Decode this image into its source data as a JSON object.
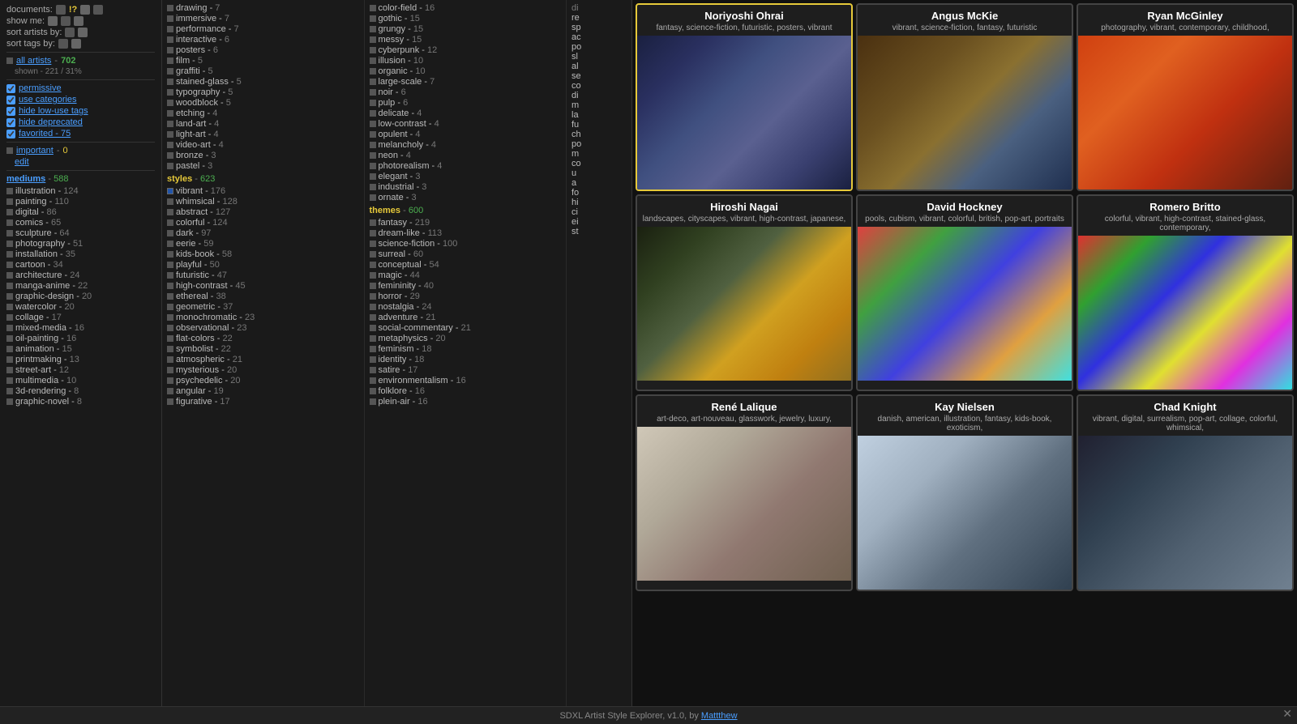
{
  "header": {
    "documents_label": "documents:",
    "show_me_label": "show me:",
    "sort_artists_label": "sort artists by:",
    "sort_tags_label": "sort tags by:"
  },
  "filters": {
    "all_artists_label": "all artists",
    "all_artists_count": "702",
    "shown_label": "shown - 221 / 31%",
    "permissive_label": "permissive",
    "use_categories_label": "use categories",
    "hide_low_label": "hide low-use tags",
    "hide_deprecated_label": "hide deprecated",
    "favorited_label": "favorited - 75",
    "important_label": "important",
    "important_count": "0",
    "edit_label": "edit"
  },
  "mediums": {
    "title": "mediums",
    "count": "588",
    "items": [
      {
        "label": "illustration",
        "count": "124"
      },
      {
        "label": "painting",
        "count": "110"
      },
      {
        "label": "digital",
        "count": "86"
      },
      {
        "label": "comics",
        "count": "65"
      },
      {
        "label": "sculpture",
        "count": "64"
      },
      {
        "label": "photography",
        "count": "51"
      },
      {
        "label": "installation",
        "count": "35"
      },
      {
        "label": "cartoon",
        "count": "34"
      },
      {
        "label": "architecture",
        "count": "24"
      },
      {
        "label": "manga-anime",
        "count": "22"
      },
      {
        "label": "graphic-design",
        "count": "20"
      },
      {
        "label": "watercolor",
        "count": "20"
      },
      {
        "label": "collage",
        "count": "17"
      },
      {
        "label": "mixed-media",
        "count": "16"
      },
      {
        "label": "oil-painting",
        "count": "16"
      },
      {
        "label": "animation",
        "count": "15"
      },
      {
        "label": "printmaking",
        "count": "13"
      },
      {
        "label": "street-art",
        "count": "12"
      },
      {
        "label": "multimedia",
        "count": "10"
      },
      {
        "label": "3d-rendering",
        "count": "8"
      },
      {
        "label": "graphic-novel",
        "count": "8"
      }
    ]
  },
  "styles_col": {
    "title": "styles",
    "count": "623",
    "items": [
      {
        "label": "drawing",
        "count": "7",
        "checked": false
      },
      {
        "label": "immersive",
        "count": "7",
        "checked": false
      },
      {
        "label": "performance",
        "count": "7",
        "checked": false
      },
      {
        "label": "interactive",
        "count": "6",
        "checked": false
      },
      {
        "label": "posters",
        "count": "6",
        "checked": false
      },
      {
        "label": "film",
        "count": "5",
        "checked": false
      },
      {
        "label": "graffiti",
        "count": "5",
        "checked": false
      },
      {
        "label": "stained-glass",
        "count": "5",
        "checked": false
      },
      {
        "label": "typography",
        "count": "5",
        "checked": false
      },
      {
        "label": "woodblock",
        "count": "5",
        "checked": false
      },
      {
        "label": "etching",
        "count": "4",
        "checked": false
      },
      {
        "label": "land-art",
        "count": "4",
        "checked": false
      },
      {
        "label": "light-art",
        "count": "4",
        "checked": false
      },
      {
        "label": "video-art",
        "count": "4",
        "checked": false
      },
      {
        "label": "bronze",
        "count": "3",
        "checked": false
      },
      {
        "label": "pastel",
        "count": "3",
        "checked": false
      }
    ],
    "styles_items": [
      {
        "label": "vibrant",
        "count": "176",
        "checked": true
      },
      {
        "label": "whimsical",
        "count": "128",
        "checked": false
      },
      {
        "label": "abstract",
        "count": "127",
        "checked": false
      },
      {
        "label": "colorful",
        "count": "124",
        "checked": false
      },
      {
        "label": "dark",
        "count": "97",
        "checked": false
      },
      {
        "label": "eerie",
        "count": "59",
        "checked": false
      },
      {
        "label": "kids-book",
        "count": "58",
        "checked": false
      },
      {
        "label": "playful",
        "count": "50",
        "checked": false
      },
      {
        "label": "futuristic",
        "count": "47",
        "checked": false
      },
      {
        "label": "high-contrast",
        "count": "45",
        "checked": false
      },
      {
        "label": "ethereal",
        "count": "38",
        "checked": false
      },
      {
        "label": "geometric",
        "count": "37",
        "checked": false
      },
      {
        "label": "monochromatic",
        "count": "23",
        "checked": false
      },
      {
        "label": "observational",
        "count": "23",
        "checked": false
      },
      {
        "label": "flat-colors",
        "count": "22",
        "checked": false
      },
      {
        "label": "symbolist",
        "count": "22",
        "checked": false
      },
      {
        "label": "atmospheric",
        "count": "21",
        "checked": false
      },
      {
        "label": "mysterious",
        "count": "20",
        "checked": false
      },
      {
        "label": "psychedelic",
        "count": "20",
        "checked": false
      },
      {
        "label": "angular",
        "count": "19",
        "checked": false
      },
      {
        "label": "figurative",
        "count": "17",
        "checked": false
      }
    ]
  },
  "col2": {
    "items": [
      {
        "label": "color-field",
        "count": "16"
      },
      {
        "label": "gothic",
        "count": "15"
      },
      {
        "label": "grungy",
        "count": "15"
      },
      {
        "label": "messy",
        "count": "15"
      },
      {
        "label": "cyberpunk",
        "count": "12"
      },
      {
        "label": "illusion",
        "count": "10"
      },
      {
        "label": "organic",
        "count": "10"
      },
      {
        "label": "large-scale",
        "count": "7"
      },
      {
        "label": "noir",
        "count": "6"
      },
      {
        "label": "pulp",
        "count": "6"
      },
      {
        "label": "delicate",
        "count": "4"
      },
      {
        "label": "low-contrast",
        "count": "4"
      },
      {
        "label": "opulent",
        "count": "4"
      },
      {
        "label": "melancholy",
        "count": "4"
      },
      {
        "label": "neon",
        "count": "4"
      },
      {
        "label": "photorealism",
        "count": "4"
      },
      {
        "label": "elegant",
        "count": "3"
      },
      {
        "label": "industrial",
        "count": "3"
      },
      {
        "label": "ornate",
        "count": "3"
      }
    ],
    "themes_title": "themes",
    "themes_count": "600",
    "themes_items": [
      {
        "label": "fantasy",
        "count": "219"
      },
      {
        "label": "dream-like",
        "count": "113"
      },
      {
        "label": "science-fiction",
        "count": "100"
      },
      {
        "label": "surreal",
        "count": "60"
      },
      {
        "label": "conceptual",
        "count": "54"
      },
      {
        "label": "magic",
        "count": "44"
      },
      {
        "label": "femininity",
        "count": "40"
      },
      {
        "label": "horror",
        "count": "29"
      },
      {
        "label": "nostalgia",
        "count": "24"
      },
      {
        "label": "adventure",
        "count": "21"
      },
      {
        "label": "social-commentary",
        "count": "21"
      },
      {
        "label": "metaphysics",
        "count": "20"
      },
      {
        "label": "feminism",
        "count": "18"
      },
      {
        "label": "identity",
        "count": "18"
      },
      {
        "label": "satire",
        "count": "17"
      },
      {
        "label": "environmentalism",
        "count": "16"
      },
      {
        "label": "folklore",
        "count": "16"
      },
      {
        "label": "plein-air",
        "count": "16"
      }
    ]
  },
  "footer": {
    "text": "SDXL Artist Style Explorer, v1.0, by",
    "author": "Mattthew"
  },
  "artists": [
    {
      "name": "Noriyoshi Ohrai",
      "tags": "fantasy, science-fiction, futuristic, posters, vibrant",
      "img_class": "img-noriyoshi",
      "selected": true
    },
    {
      "name": "Angus McKie",
      "tags": "vibrant, science-fiction, fantasy, futuristic",
      "img_class": "img-angus",
      "selected": false
    },
    {
      "name": "Ryan McGinley",
      "tags": "photography, vibrant, contemporary, childhood,",
      "img_class": "img-ryan",
      "selected": false
    },
    {
      "name": "Hiroshi Nagai",
      "tags": "landscapes, cityscapes, vibrant, high-contrast, japanese,",
      "img_class": "img-hiroshi",
      "selected": false
    },
    {
      "name": "David Hockney",
      "tags": "pools, cubism, vibrant, colorful, british, pop-art, portraits",
      "img_class": "img-hockney",
      "selected": false
    },
    {
      "name": "Romero Britto",
      "tags": "colorful, vibrant, high-contrast, stained-glass, contemporary,",
      "img_class": "img-britto",
      "selected": false
    },
    {
      "name": "René Lalique",
      "tags": "art-deco, art-nouveau, glasswork, jewelry, luxury,",
      "img_class": "img-rene",
      "selected": false
    },
    {
      "name": "Kay Nielsen",
      "tags": "danish, american, illustration, fantasy, kids-book, exoticism,",
      "img_class": "img-kay",
      "selected": false
    },
    {
      "name": "Chad Knight",
      "tags": "vibrant, digital, surrealism, pop-art, collage, colorful, whimsical,",
      "img_class": "img-chad",
      "selected": false
    }
  ]
}
